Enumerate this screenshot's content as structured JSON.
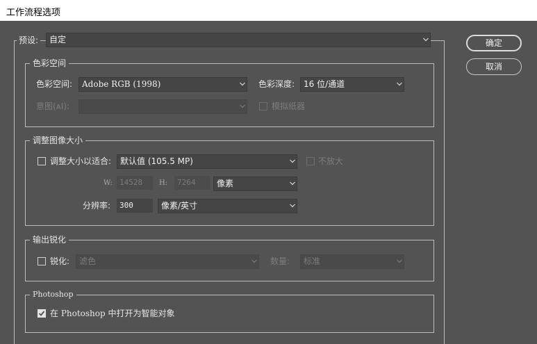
{
  "window": {
    "title": "工作流程选项"
  },
  "preset": {
    "label": "预设:",
    "value": "自定"
  },
  "buttons": {
    "ok": "确定",
    "cancel": "取消"
  },
  "color_space_group": {
    "title": "色彩空间",
    "color_space_label": "色彩空间:",
    "color_space_value": "Adobe RGB (1998)",
    "depth_label": "色彩深度:",
    "depth_value": "16 位/通道",
    "intent_label": "意图(ᴀI):",
    "intent_value": "",
    "simulate_paper_label": "模拟纸器"
  },
  "resize_group": {
    "title": "调整图像大小",
    "resize_label": "调整大小以适合:",
    "resize_value": "默认值 (105.5 MP)",
    "no_enlarge_label": "不放大",
    "w_label": "W:",
    "w_value": "14528",
    "h_label": "H:",
    "h_value": "7264",
    "unit_value": "像素",
    "resolution_label": "分辨率:",
    "resolution_value": "300",
    "resolution_unit": "像素/英寸"
  },
  "sharpen_group": {
    "title": "输出锐化",
    "sharpen_label": "锐化:",
    "sharpen_value": "滤色",
    "amount_label": "数量:",
    "amount_value": "标准"
  },
  "photoshop_group": {
    "title": "Photoshop",
    "open_smart_label": "在 Photoshop 中打开为智能对象",
    "open_smart_checked": true
  }
}
